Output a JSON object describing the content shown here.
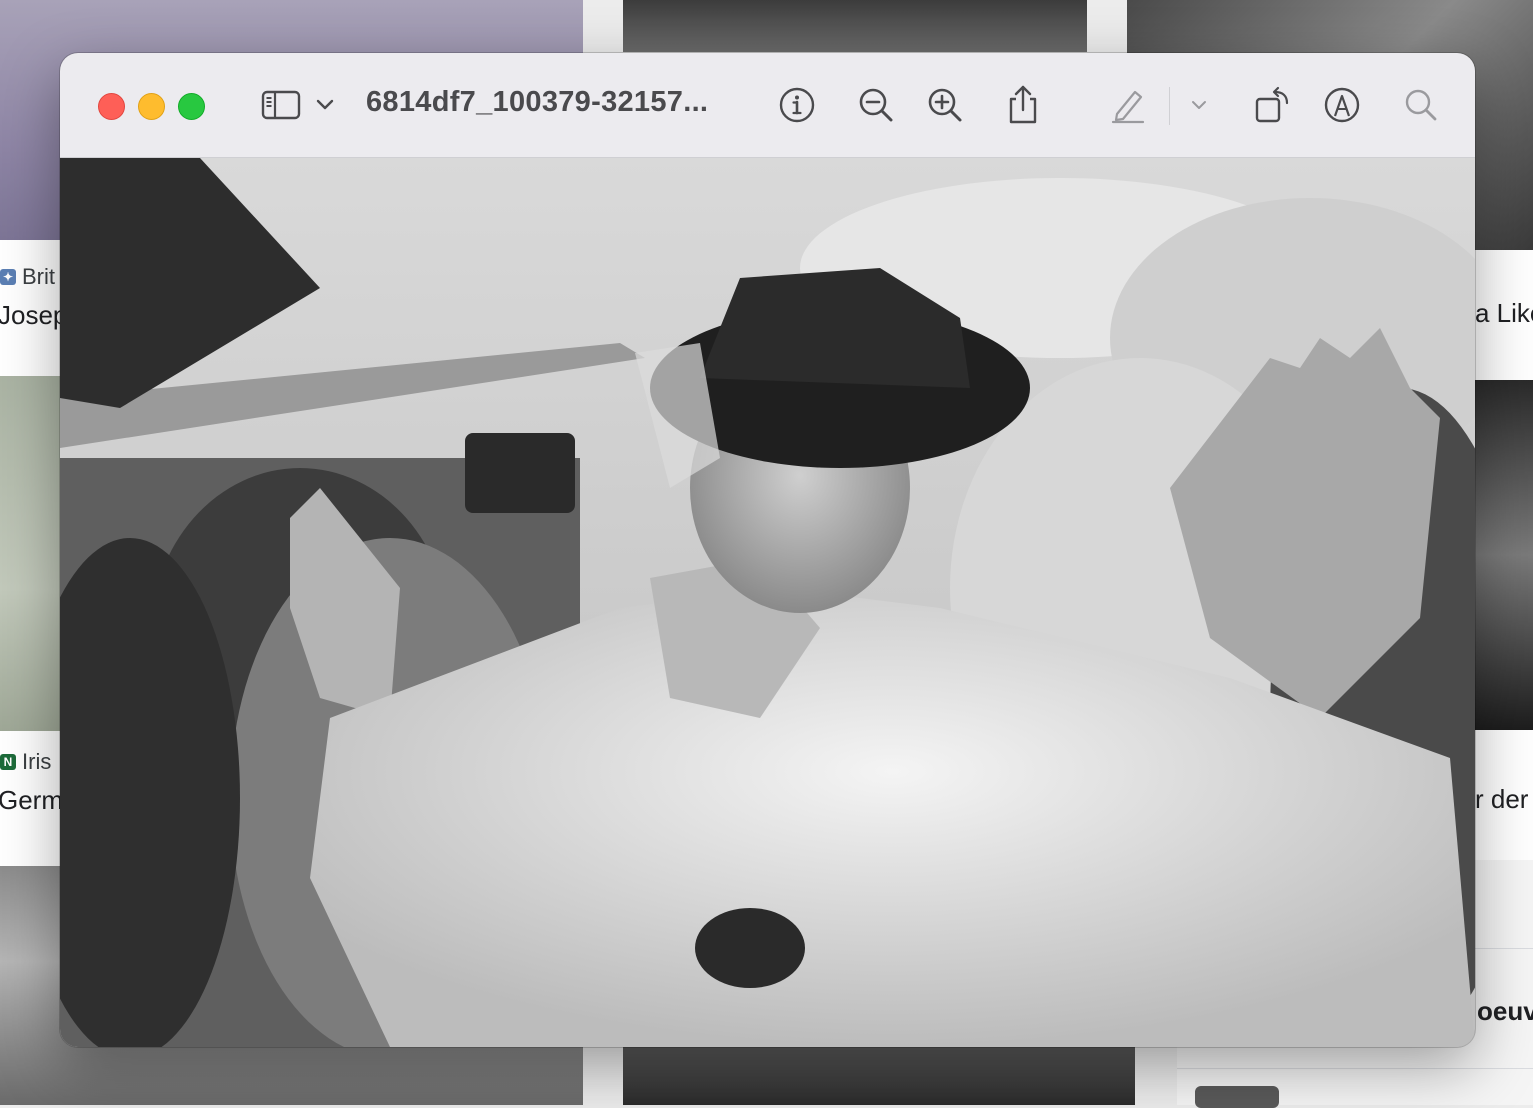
{
  "background": {
    "cards": [
      {
        "source": "Brit",
        "title": "Josep",
        "badge_color": "#5b7fb4"
      },
      {
        "source": "",
        "title": "a Like",
        "badge_color": ""
      },
      {
        "source": "Iris",
        "title": "Germ",
        "badge_color": "#1d6b3a"
      },
      {
        "source": "",
        "title": "r der",
        "badge_color": ""
      },
      {
        "source": "",
        "title": "oeuv",
        "badge_color": ""
      }
    ]
  },
  "window": {
    "title": "6814df7_100379-32157...",
    "toolbar": {
      "sidebar_icon": "sidebar-icon",
      "sidebar_menu_icon": "chevron-down-icon",
      "info_icon": "info-icon",
      "zoom_out_icon": "zoom-out-icon",
      "zoom_in_icon": "zoom-in-icon",
      "share_icon": "share-icon",
      "markup_icon": "pencil-icon",
      "markup_menu_icon": "chevron-down-icon",
      "rotate_icon": "rotate-icon",
      "annotate_icon": "markup-icon",
      "search_icon": "search-icon"
    }
  },
  "colors": {
    "close": "#fe5f57",
    "minimize": "#febc2e",
    "zoom": "#28c840",
    "titlebar": "#ecebef"
  }
}
